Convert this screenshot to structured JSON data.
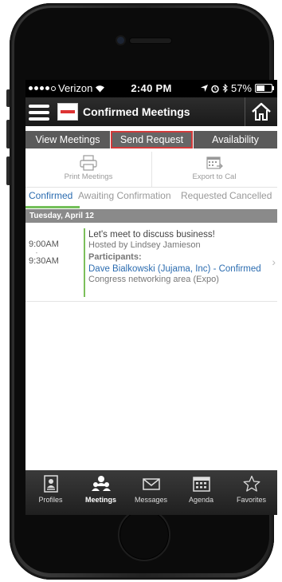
{
  "status_bar": {
    "carrier": "Verizon",
    "time": "2:40 PM",
    "battery": "57%",
    "battery_level": 0.57
  },
  "app_bar": {
    "title": "Confirmed Meetings"
  },
  "segments": [
    {
      "label": "View Meetings"
    },
    {
      "label": "Send Request"
    },
    {
      "label": "Availability"
    }
  ],
  "actions": {
    "print_label": "Print Meetings",
    "export_label": "Export to Cal"
  },
  "tabs": [
    {
      "label": "Confirmed"
    },
    {
      "label": "Awaiting Confirmation"
    },
    {
      "label": "Requested"
    },
    {
      "label": "Cancelled"
    }
  ],
  "date_header": "Tuesday, April 12",
  "meeting": {
    "start_time": "9:00AM",
    "separator": "-",
    "end_time": "9:30AM",
    "title": "Let's meet to discuss business!",
    "host": "Hosted by Lindsey Jamieson",
    "participants_label": "Participants:",
    "participant": "Dave Bialkowski (Jujama, Inc) - Confirmed",
    "location": "Congress networking area (Expo)"
  },
  "bottom_nav": [
    {
      "label": "Profiles",
      "icon": "profile-icon"
    },
    {
      "label": "Meetings",
      "icon": "meetings-icon"
    },
    {
      "label": "Messages",
      "icon": "envelope-icon"
    },
    {
      "label": "Agenda",
      "icon": "calendar-icon"
    },
    {
      "label": "Favorites",
      "icon": "star-icon"
    }
  ]
}
